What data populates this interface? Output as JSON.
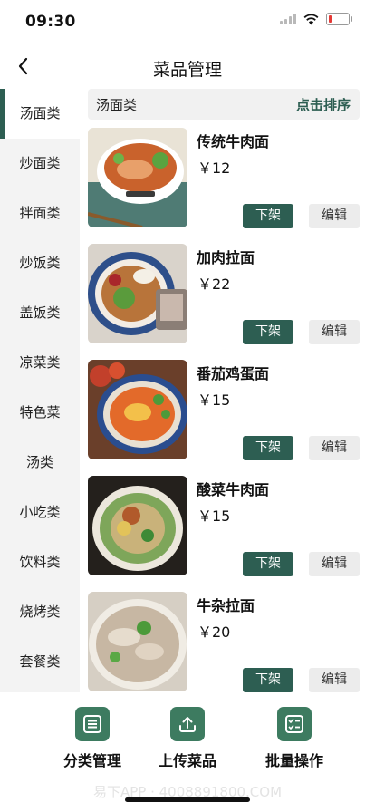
{
  "status": {
    "time": "09:30"
  },
  "nav": {
    "title": "菜品管理"
  },
  "sidebar": {
    "items": [
      {
        "label": "汤面类"
      },
      {
        "label": "炒面类"
      },
      {
        "label": "拌面类"
      },
      {
        "label": "炒饭类"
      },
      {
        "label": "盖饭类"
      },
      {
        "label": "凉菜类"
      },
      {
        "label": "特色菜"
      },
      {
        "label": "汤类"
      },
      {
        "label": "小吃类"
      },
      {
        "label": "饮料类"
      },
      {
        "label": "烧烤类"
      },
      {
        "label": "套餐类"
      }
    ]
  },
  "category": {
    "name": "汤面类",
    "sort_label": "点击排序"
  },
  "dishes": [
    {
      "name": "传统牛肉面",
      "price": "￥12",
      "off_label": "下架",
      "edit_label": "编辑"
    },
    {
      "name": "加肉拉面",
      "price": "￥22",
      "off_label": "下架",
      "edit_label": "编辑"
    },
    {
      "name": "番茄鸡蛋面",
      "price": "￥15",
      "off_label": "下架",
      "edit_label": "编辑"
    },
    {
      "name": "酸菜牛肉面",
      "price": "￥15",
      "off_label": "下架",
      "edit_label": "编辑"
    },
    {
      "name": "牛杂拉面",
      "price": "￥20",
      "off_label": "下架",
      "edit_label": "编辑"
    }
  ],
  "bottom": {
    "tabs": [
      {
        "label": "分类管理",
        "icon": "list-icon"
      },
      {
        "label": "上传菜品",
        "icon": "upload-icon"
      },
      {
        "label": "批量操作",
        "icon": "checklist-icon"
      }
    ],
    "watermark": "易下APP · 4008891800.COM"
  },
  "colors": {
    "accent": "#2d5e52",
    "tab_icon": "#3d7b60"
  }
}
